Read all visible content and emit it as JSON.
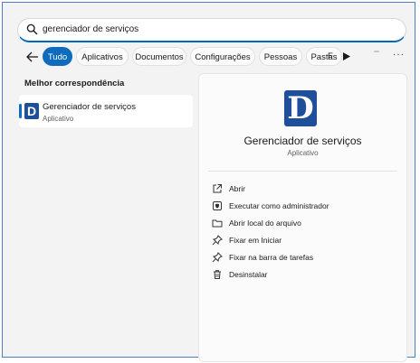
{
  "search": {
    "value": "gerenciador de serviços",
    "icon": "search-icon"
  },
  "nav": {
    "back_icon": "arrow-left-icon",
    "tabs": [
      {
        "label": "Tudo",
        "active": true
      },
      {
        "label": "Aplicativos"
      },
      {
        "label": "Documentos"
      },
      {
        "label": "Configurações"
      },
      {
        "label": "Pessoas"
      },
      {
        "label": "Pastas"
      },
      {
        "label": "F"
      }
    ],
    "more_label": "···"
  },
  "results": {
    "section_title": "Melhor correspondência",
    "best_match": {
      "name": "Gerenciador de serviços",
      "type": "Aplicativo",
      "icon_letter": "D"
    }
  },
  "detail": {
    "icon_letter": "D",
    "title": "Gerenciador de serviços",
    "subtitle": "Aplicativo",
    "actions": [
      {
        "label": "Abrir",
        "icon": "open-icon"
      },
      {
        "label": "Executar como administrador",
        "icon": "shield-icon"
      },
      {
        "label": "Abrir local do arquivo",
        "icon": "folder-icon"
      },
      {
        "label": "Fixar em Iniciar",
        "icon": "pin-icon"
      },
      {
        "label": "Fixar na barra de tarefas",
        "icon": "pin-icon"
      },
      {
        "label": "Desinstalar",
        "icon": "trash-icon"
      }
    ]
  },
  "colors": {
    "accent": "#0f6cbd",
    "app_icon": "#1f4f9a",
    "frame_border": "#4a7fc6"
  }
}
